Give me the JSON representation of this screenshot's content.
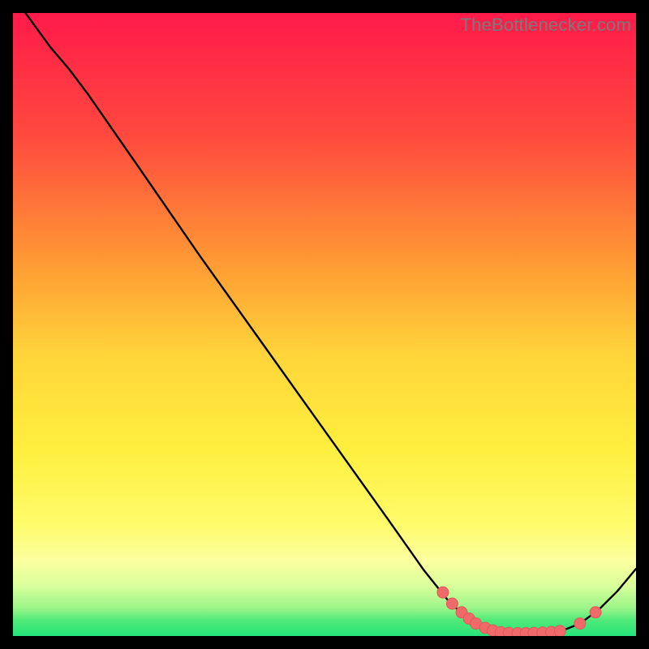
{
  "watermark": "TheBottlenecker.com",
  "colors": {
    "bg_black": "#000000",
    "grad_top": "#ff1a4a",
    "grad_mid": "#ffe63a",
    "grad_green": "#2ee86e",
    "curve": "#000000",
    "marker_fill": "#f06a6a",
    "marker_stroke": "#e05858"
  },
  "chart_data": {
    "type": "line",
    "title": "",
    "xlabel": "",
    "ylabel": "",
    "xlim": [
      0,
      100
    ],
    "ylim": [
      0,
      100
    ],
    "gradient_stops": [
      {
        "offset": 0.0,
        "color": "#ff1a4a"
      },
      {
        "offset": 0.2,
        "color": "#ff4a3e"
      },
      {
        "offset": 0.4,
        "color": "#ff9a34"
      },
      {
        "offset": 0.55,
        "color": "#ffd53a"
      },
      {
        "offset": 0.7,
        "color": "#ffef3e"
      },
      {
        "offset": 0.82,
        "color": "#fffb6a"
      },
      {
        "offset": 0.88,
        "color": "#fbffa0"
      },
      {
        "offset": 0.92,
        "color": "#d8ff9a"
      },
      {
        "offset": 0.955,
        "color": "#9cf58a"
      },
      {
        "offset": 0.975,
        "color": "#4fe978"
      },
      {
        "offset": 1.0,
        "color": "#25e47a"
      }
    ],
    "curve_points": [
      {
        "x": 2.0,
        "y": 100.0
      },
      {
        "x": 6.0,
        "y": 94.5
      },
      {
        "x": 9.0,
        "y": 91.0
      },
      {
        "x": 12.0,
        "y": 87.0
      },
      {
        "x": 20.0,
        "y": 75.5
      },
      {
        "x": 30.0,
        "y": 61.0
      },
      {
        "x": 40.0,
        "y": 47.0
      },
      {
        "x": 50.0,
        "y": 33.0
      },
      {
        "x": 60.0,
        "y": 19.0
      },
      {
        "x": 66.0,
        "y": 10.5
      },
      {
        "x": 70.0,
        "y": 5.5
      },
      {
        "x": 73.0,
        "y": 2.8
      },
      {
        "x": 76.0,
        "y": 1.2
      },
      {
        "x": 80.0,
        "y": 0.5
      },
      {
        "x": 84.0,
        "y": 0.5
      },
      {
        "x": 88.0,
        "y": 0.8
      },
      {
        "x": 91.0,
        "y": 2.0
      },
      {
        "x": 94.0,
        "y": 4.2
      },
      {
        "x": 97.0,
        "y": 7.2
      },
      {
        "x": 100.0,
        "y": 10.8
      }
    ],
    "markers": [
      {
        "x": 69.0,
        "y": 7.0
      },
      {
        "x": 70.5,
        "y": 5.2
      },
      {
        "x": 72.0,
        "y": 3.8
      },
      {
        "x": 73.2,
        "y": 2.8
      },
      {
        "x": 74.3,
        "y": 2.0
      },
      {
        "x": 75.8,
        "y": 1.3
      },
      {
        "x": 77.0,
        "y": 0.9
      },
      {
        "x": 78.3,
        "y": 0.6
      },
      {
        "x": 79.6,
        "y": 0.5
      },
      {
        "x": 81.0,
        "y": 0.45
      },
      {
        "x": 82.3,
        "y": 0.45
      },
      {
        "x": 83.6,
        "y": 0.5
      },
      {
        "x": 85.0,
        "y": 0.55
      },
      {
        "x": 86.4,
        "y": 0.65
      },
      {
        "x": 87.8,
        "y": 0.8
      },
      {
        "x": 91.0,
        "y": 2.0
      },
      {
        "x": 93.5,
        "y": 3.8
      }
    ],
    "marker_radius": 7
  }
}
